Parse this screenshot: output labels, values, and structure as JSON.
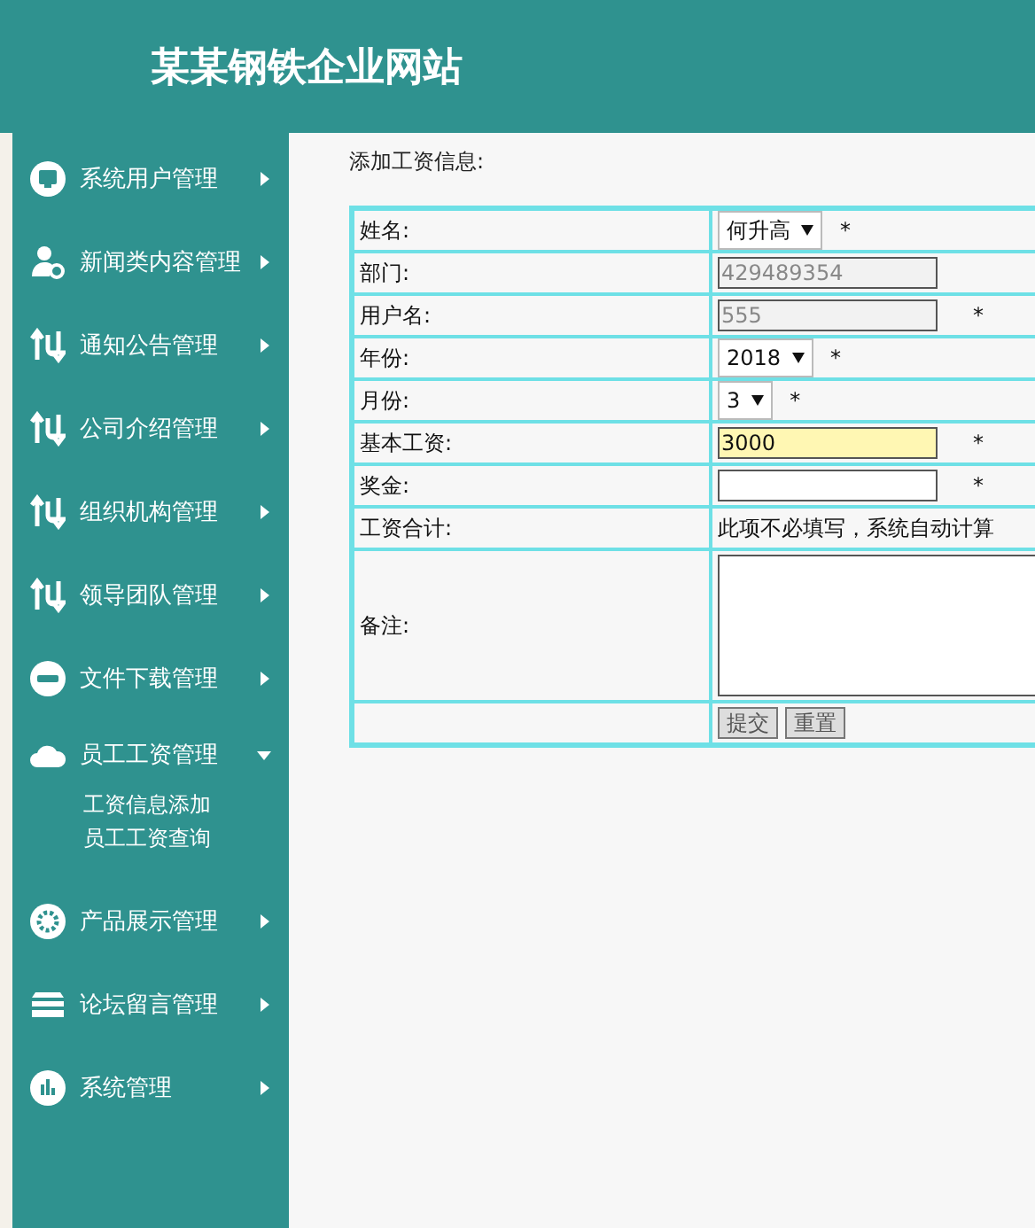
{
  "header": {
    "title": "某某钢铁企业网站"
  },
  "sidebar": {
    "items": [
      {
        "label": "系统用户管理",
        "expanded": false
      },
      {
        "label": "新闻类内容管理",
        "expanded": false
      },
      {
        "label": "通知公告管理",
        "expanded": false
      },
      {
        "label": "公司介绍管理",
        "expanded": false
      },
      {
        "label": "组织机构管理",
        "expanded": false
      },
      {
        "label": "领导团队管理",
        "expanded": false
      },
      {
        "label": "文件下载管理",
        "expanded": false
      },
      {
        "label": "员工工资管理",
        "expanded": true,
        "children": [
          {
            "label": "工资信息添加"
          },
          {
            "label": "员工工资查询"
          }
        ]
      },
      {
        "label": "产品展示管理",
        "expanded": false
      },
      {
        "label": "论坛留言管理",
        "expanded": false
      },
      {
        "label": "系统管理",
        "expanded": false
      }
    ]
  },
  "form": {
    "title": "添加工资信息:",
    "rows": [
      {
        "kind": "select",
        "label": "姓名:",
        "value": "何升高",
        "mark": "*"
      },
      {
        "kind": "input",
        "label": "部门:",
        "value": "429489354",
        "readonly": true,
        "focused": false
      },
      {
        "kind": "input",
        "label": "用户名:",
        "value": "555",
        "readonly": true,
        "focused": false,
        "mark": "*"
      },
      {
        "kind": "select",
        "label": "年份:",
        "value": "2018",
        "mark": "*"
      },
      {
        "kind": "select",
        "label": "月份:",
        "value": "3",
        "mark": "*"
      },
      {
        "kind": "input",
        "label": "基本工资:",
        "value": "3000",
        "readonly": false,
        "focused": true,
        "mark": "*"
      },
      {
        "kind": "input",
        "label": "奖金:",
        "value": "",
        "readonly": false,
        "focused": false,
        "mark": "*"
      },
      {
        "kind": "note",
        "label": "工资合计:",
        "value": "此项不必填写，系统自动计算"
      },
      {
        "kind": "textarea",
        "label": "备注:"
      },
      {
        "kind": "buttons",
        "buttons": [
          "提交",
          "重置"
        ]
      }
    ]
  }
}
